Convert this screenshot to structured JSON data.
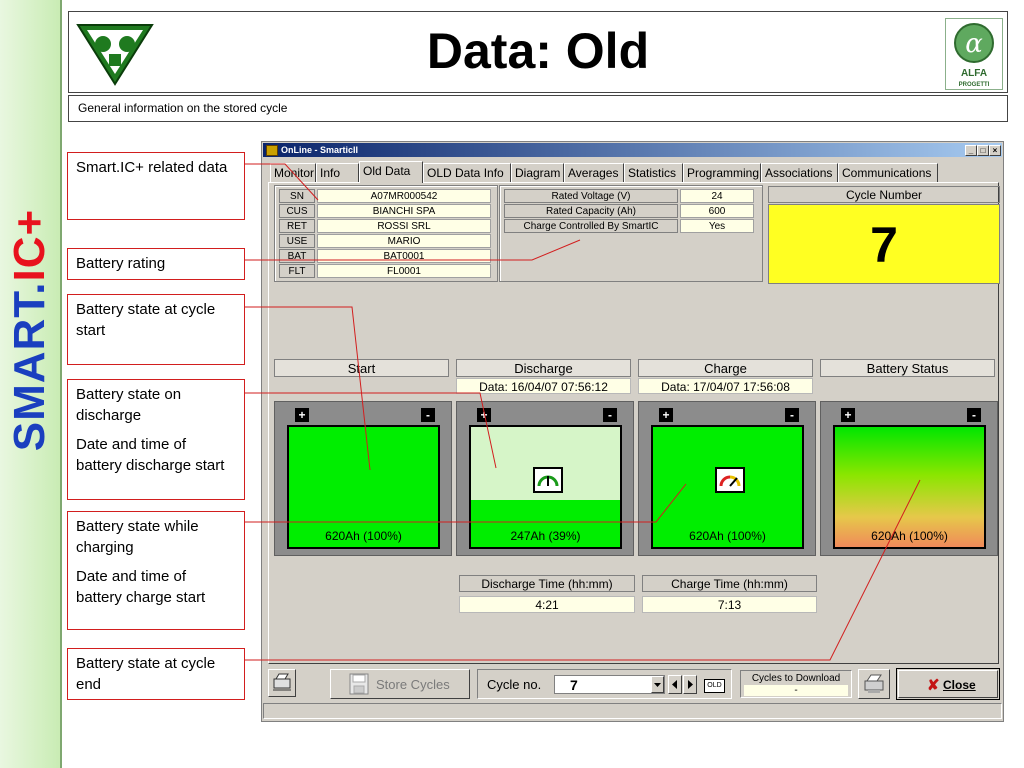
{
  "brand": {
    "part1": "SMART.",
    "part2": "IC+"
  },
  "header": {
    "title": "Data: Old",
    "left_logo": "pbm-logo",
    "right_logo": "alfa-progetti-logo",
    "right_logo_text": "ALFA",
    "right_logo_subtext": "PROGETTI"
  },
  "subtitle": "General information on the stored cycle",
  "annotations": [
    {
      "lines": [
        "Smart.IC+ related data"
      ]
    },
    {
      "lines": [
        "Battery rating"
      ]
    },
    {
      "lines": [
        "Battery state at cycle start"
      ]
    },
    {
      "lines": [
        "Battery state on discharge",
        "Date and time of battery discharge start"
      ]
    },
    {
      "lines": [
        "Battery state while charging",
        "Date and time of battery charge start"
      ]
    },
    {
      "lines": [
        "Battery state at cycle end"
      ]
    }
  ],
  "window": {
    "title": "OnLine - SmarticII",
    "controls": [
      "_",
      "□",
      "×"
    ],
    "tabs": [
      "Monitor",
      "Info",
      "Old Data",
      "OLD Data Info",
      "Diagram",
      "Averages",
      "Statistics",
      "Programming",
      "Associations",
      "Communications"
    ],
    "active_tab": "Old Data"
  },
  "smartic_data": {
    "rows": [
      {
        "key": "SN",
        "value": "A07MR000542"
      },
      {
        "key": "CUS",
        "value": "BIANCHI SPA"
      },
      {
        "key": "RET",
        "value": "ROSSI SRL"
      },
      {
        "key": "USE",
        "value": "MARIO"
      },
      {
        "key": "BAT",
        "value": "BAT0001"
      },
      {
        "key": "FLT",
        "value": "FL0001"
      }
    ]
  },
  "rating": {
    "rows": [
      {
        "key": "Rated Voltage (V)",
        "value": "24"
      },
      {
        "key": "Rated Capacity (Ah)",
        "value": "600"
      },
      {
        "key": "Charge Controlled By SmartIC",
        "value": "Yes"
      }
    ]
  },
  "cycle": {
    "label": "Cycle Number",
    "number": "7"
  },
  "columns": [
    {
      "head": "Start",
      "date": "",
      "battery_label": "620Ah (100%)",
      "charge_fraction": 1.0,
      "style": "full",
      "gauge": ""
    },
    {
      "head": "Discharge",
      "date": "Data: 16/04/07 07:56:12",
      "battery_label": "247Ah (39%)",
      "charge_fraction": 0.39,
      "style": "partial",
      "gauge": "discharge-gauge-icon"
    },
    {
      "head": "Charge",
      "date": "Data: 17/04/07 17:56:08",
      "battery_label": "620Ah (100%)",
      "charge_fraction": 1.0,
      "style": "full",
      "gauge": "charge-gauge-icon"
    },
    {
      "head": "Battery Status",
      "date": "",
      "battery_label": "620Ah (100%)",
      "charge_fraction": 1.0,
      "style": "gradient",
      "gauge": ""
    }
  ],
  "times": {
    "discharge_label": "Discharge Time (hh:mm)",
    "discharge_value": "4:21",
    "charge_label": "Charge Time (hh:mm)",
    "charge_value": "7:13"
  },
  "toolbar": {
    "store_cycles": "Store Cycles",
    "cycle_no_label": "Cycle no.",
    "cycle_no_value": "7",
    "old_label": "OLD",
    "cycles_to_download_label": "Cycles to Download",
    "cycles_to_download_value": "-",
    "close_label": "Close"
  },
  "colors": {
    "charge_green": "#00ee00",
    "cycle_yellow": "#ffff22",
    "leader_red": "#d21e1e",
    "brand_blue": "#1a3fbf",
    "brand_red": "#e8121d"
  }
}
